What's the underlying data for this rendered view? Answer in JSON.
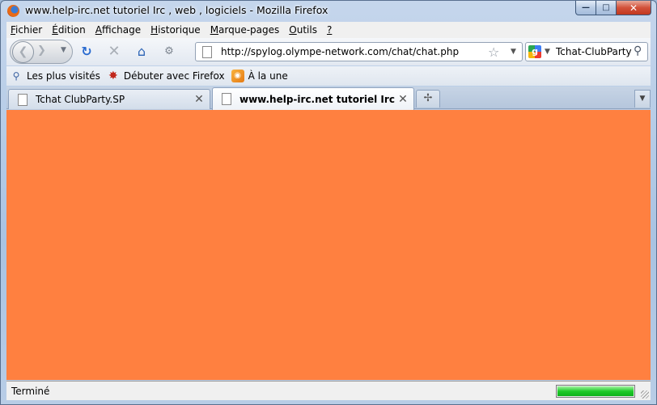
{
  "window": {
    "title": "www.help-irc.net tutoriel Irc , web , logiciels - Mozilla Firefox",
    "minimize_glyph": "—",
    "maximize_glyph": "□",
    "close_glyph": "✕"
  },
  "menubar": {
    "items": [
      {
        "accel": "F",
        "rest": "ichier"
      },
      {
        "accel": "É",
        "rest": "dition"
      },
      {
        "accel": "A",
        "rest": "ffichage"
      },
      {
        "accel": "H",
        "rest": "istorique"
      },
      {
        "accel": "M",
        "rest": "arque-pages"
      },
      {
        "accel": "O",
        "rest": "utils"
      },
      {
        "accel": "?",
        "rest": ""
      }
    ]
  },
  "navbar": {
    "url": "http://spylog.olympe-network.com/chat/chat.php",
    "search_engine_icon": "google-icon",
    "search_text": "Tchat-ClubParty",
    "icons": {
      "back": "back-arrow-icon",
      "forward": "forward-arrow-icon",
      "reload": "reload-icon",
      "stop": "stop-icon",
      "home": "home-icon",
      "bookmark": "star-icon",
      "search": "magnifier-icon"
    }
  },
  "bookmarks": {
    "items": [
      {
        "label": "Les plus visités",
        "icon": "most-visited-icon"
      },
      {
        "label": "Débuter avec Firefox",
        "icon": "firefox-icon"
      },
      {
        "label": "À la une",
        "icon": "rss-feed-icon"
      }
    ]
  },
  "tabs": [
    {
      "title": "Tchat ClubParty.SP",
      "active": false
    },
    {
      "title": "www.help-irc.net tutoriel Irc , we...",
      "active": true
    }
  ],
  "content": {
    "background_color": "#ff8040"
  },
  "statusbar": {
    "text": "Terminé",
    "progress_percent": 100
  }
}
